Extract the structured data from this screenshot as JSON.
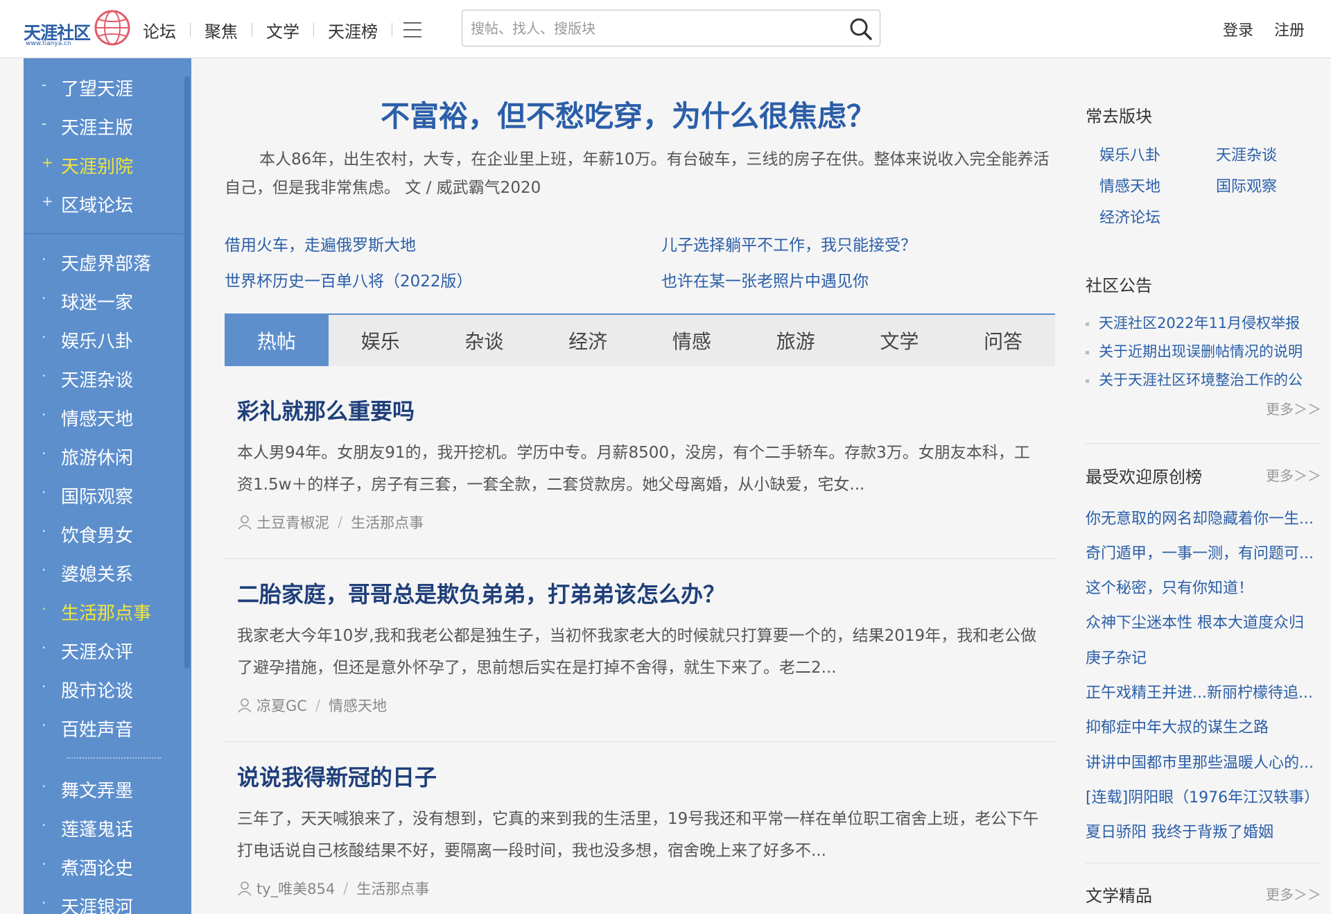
{
  "header": {
    "logo_text": "天涯社区",
    "logo_sub": "www.tianya.cn",
    "nav": [
      "论坛",
      "聚焦",
      "文学",
      "天涯榜"
    ],
    "search_placeholder": "搜帖、找人、搜版块",
    "login": "登录",
    "register": "注册"
  },
  "sidebar": {
    "group1": [
      {
        "label": "了望天涯",
        "mark": "-"
      },
      {
        "label": "天涯主版",
        "mark": "-"
      },
      {
        "label": "天涯别院",
        "mark": "+"
      },
      {
        "label": "区域论坛",
        "mark": "+"
      }
    ],
    "group2": [
      {
        "label": "天虚界部落",
        "mark": "·"
      },
      {
        "label": "球迷一家",
        "mark": "·"
      },
      {
        "label": "娱乐八卦",
        "mark": "·"
      },
      {
        "label": "天涯杂谈",
        "mark": "·"
      },
      {
        "label": "情感天地",
        "mark": "·"
      },
      {
        "label": "旅游休闲",
        "mark": "·"
      },
      {
        "label": "国际观察",
        "mark": "·"
      },
      {
        "label": "饮食男女",
        "mark": "·"
      },
      {
        "label": "婆媳关系",
        "mark": "·"
      },
      {
        "label": "生活那点事",
        "mark": "·"
      },
      {
        "label": "天涯众评",
        "mark": "·"
      },
      {
        "label": "股市论谈",
        "mark": "·"
      },
      {
        "label": "百姓声音",
        "mark": "·"
      }
    ],
    "group3": [
      {
        "label": "舞文弄墨",
        "mark": "·"
      },
      {
        "label": "莲蓬鬼话",
        "mark": "·"
      },
      {
        "label": "煮酒论史",
        "mark": "·"
      },
      {
        "label": "天涯银河",
        "mark": "·"
      }
    ],
    "highlight_color": "#f2e53a"
  },
  "main": {
    "headline": "不富裕，但不愁吃穿，为什么很焦虑？",
    "lead": "本人86年，出生农村，大专，在企业里上班，年薪10万。有台破车，三线的房子在供。整体来说收入完全能养活自己，但是我非常焦虑。 文 / 威武霸气2020",
    "quick_links": [
      "借用火车，走遍俄罗斯大地",
      "儿子选择躺平不工作，我只能接受？",
      "世界杯历史一百单八将（2022版）",
      "也许在某一张老照片中遇见你"
    ],
    "tabs": [
      "热帖",
      "娱乐",
      "杂谈",
      "经济",
      "情感",
      "旅游",
      "文学",
      "问答"
    ],
    "active_tab": "热帖",
    "posts": [
      {
        "title": "彩礼就那么重要吗",
        "excerpt": "本人男94年。女朋友91的，我开挖机。学历中专。月薪8500，没房，有个二手轿车。存款3万。女朋友本科，工资1.5w＋的样子，房子有三套，一套全款，二套贷款房。她父母离婚，从小缺爱，宅女...",
        "author": "土豆青椒泥",
        "board": "生活那点事"
      },
      {
        "title": "二胎家庭，哥哥总是欺负弟弟，打弟弟该怎么办？",
        "excerpt": "我家老大今年10岁,我和我老公都是独生子，当初怀我家老大的时候就只打算要一个的，结果2019年，我和老公做了避孕措施，但还是意外怀孕了，思前想后实在是打掉不舍得，就生下来了。老二2...",
        "author": "凉夏GC",
        "board": "情感天地"
      },
      {
        "title": "说说我得新冠的日子",
        "excerpt": "三年了，天天喊狼来了，没有想到，它真的来到我的生活里，19号我还和平常一样在单位职工宿舍上班，老公下午打电话说自己核酸结果不好，要隔离一段时间，我也没多想，宿舍晚上来了好多不...",
        "author": "ty_唯美854",
        "board": "生活那点事"
      }
    ],
    "accent_color": "#5d8fcd"
  },
  "right": {
    "fav_title": "常去版块",
    "fav_boards": [
      "娱乐八卦",
      "天涯杂谈",
      "情感天地",
      "国际观察",
      "经济论坛"
    ],
    "notice_title": "社区公告",
    "notices": [
      "天涯社区2022年11月侵权举报",
      "关于近期出现误删帖情况的说明",
      "关于天涯社区环境整治工作的公"
    ],
    "notice_more": "更多＞＞",
    "popular_title": "最受欢迎原创榜",
    "popular_more": "更多＞＞",
    "popular": [
      "你无意取的网名却隐藏着你一生...",
      "奇门遁甲，一事一测，有问题可...",
      "这个秘密，只有你知道！",
      "众神下尘迷本性 根本大道度众归",
      "庚子杂记",
      "正午戏精王并进...新丽柠檬待追...",
      "抑郁症中年大叔的谋生之路",
      "讲讲中国都市里那些温暖人心的...",
      "[连载]阴阳眼（1976年江汉轶事）",
      "夏日骄阳 我终于背叛了婚姻"
    ],
    "literature_title": "文学精品",
    "literature_more": "更多＞＞"
  }
}
